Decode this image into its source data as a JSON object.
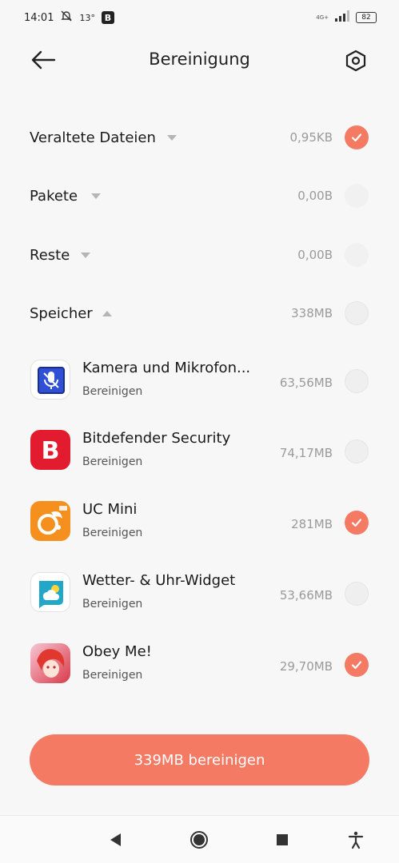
{
  "status_bar": {
    "time": "14:01",
    "temperature": "13°",
    "network": "4G+",
    "battery": "82"
  },
  "header": {
    "title": "Bereinigung"
  },
  "categories": [
    {
      "label": "Veraltete Dateien",
      "size": "0,95KB",
      "expanded": false,
      "checked": true
    },
    {
      "label": "Pakete",
      "size": "0,00B",
      "expanded": false,
      "checked": false
    },
    {
      "label": "Reste",
      "size": "0,00B",
      "expanded": false,
      "checked": false
    },
    {
      "label": "Speicher",
      "size": "338MB",
      "expanded": true,
      "checked": false
    }
  ],
  "apps": [
    {
      "name": "Kamera und Mikrofon...",
      "action": "Bereinigen",
      "size": "63,56MB",
      "checked": false,
      "icon": "camera-mic-icon"
    },
    {
      "name": "Bitdefender Security",
      "action": "Bereinigen",
      "size": "74,17MB",
      "checked": false,
      "icon": "bitdefender-icon"
    },
    {
      "name": "UC Mini",
      "action": "Bereinigen",
      "size": "281MB",
      "checked": true,
      "icon": "uc-mini-icon"
    },
    {
      "name": "Wetter- & Uhr-Widget",
      "action": "Bereinigen",
      "size": "53,66MB",
      "checked": false,
      "icon": "weather-widget-icon"
    },
    {
      "name": "Obey Me!",
      "action": "Bereinigen",
      "size": "29,70MB",
      "checked": true,
      "icon": "obey-me-icon"
    }
  ],
  "clean_button": {
    "label": "339MB bereinigen"
  },
  "colors": {
    "accent": "#f47a63",
    "background": "#f7f7f7"
  }
}
